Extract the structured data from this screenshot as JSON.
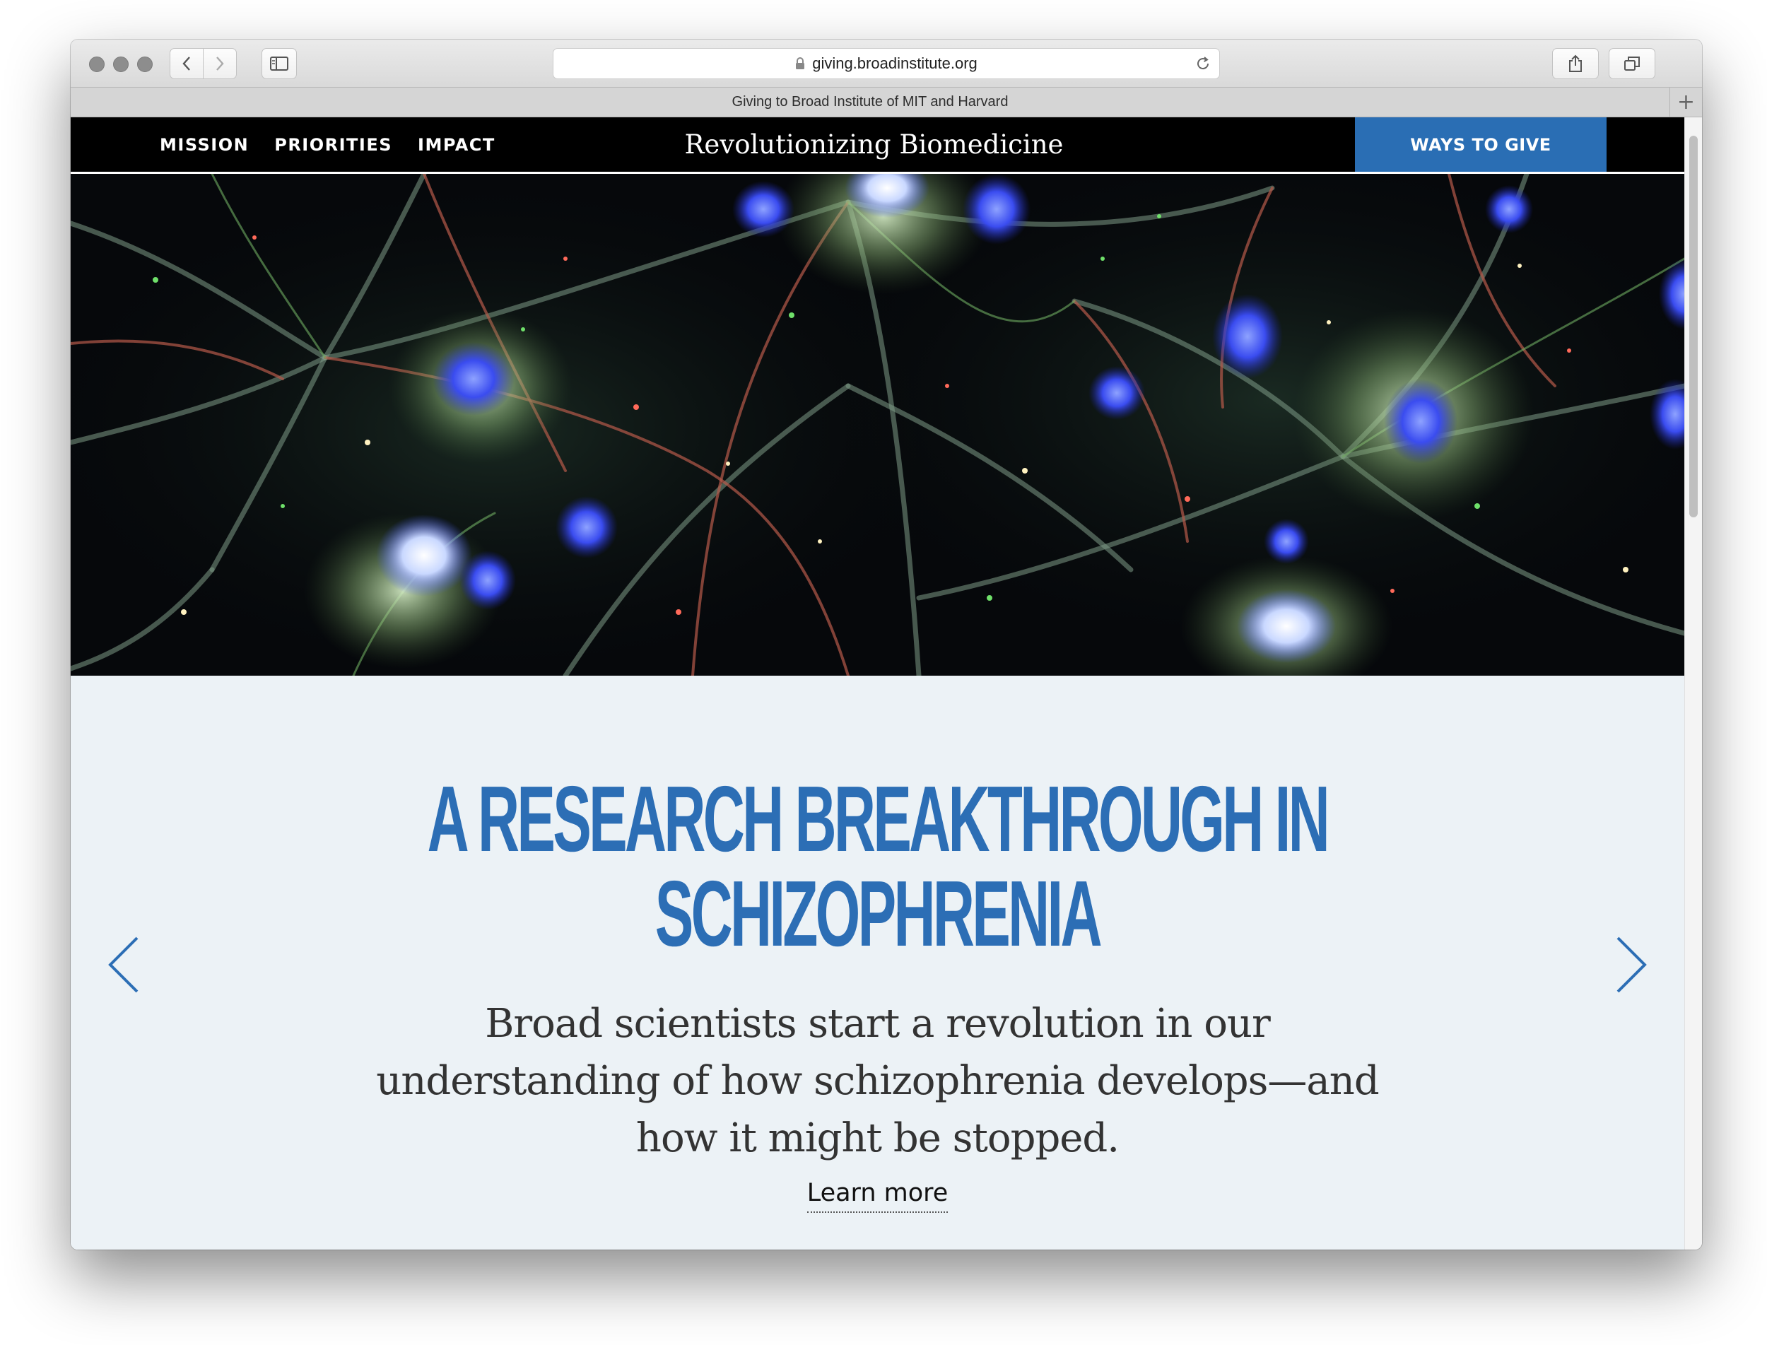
{
  "browser": {
    "url": "giving.broadinstitute.org",
    "tab_title": "Giving to Broad Institute of MIT and Harvard",
    "new_tab_label": "+"
  },
  "header": {
    "nav": [
      "MISSION",
      "PRIORITIES",
      "IMPACT"
    ],
    "title": "Revolutionizing Biomedicine",
    "cta": "WAYS TO GIVE"
  },
  "slide": {
    "headline_line1": "A RESEARCH BREAKTHROUGH IN",
    "headline_line2": "SCHIZOPHRENIA",
    "subhead": "Broad scientists start a revolution in our understanding of how schizophrenia develops—and how it might be stopped.",
    "link": "Learn more"
  },
  "colors": {
    "accent_blue": "#2a6eb4",
    "headline_blue": "#2c6eb5",
    "header_black": "#000000",
    "slide_background": "#ecf2f6"
  },
  "icons": {
    "hero_image": "neuron-microscopy-image",
    "prev": "chevron-left-icon",
    "next": "chevron-right-icon"
  }
}
